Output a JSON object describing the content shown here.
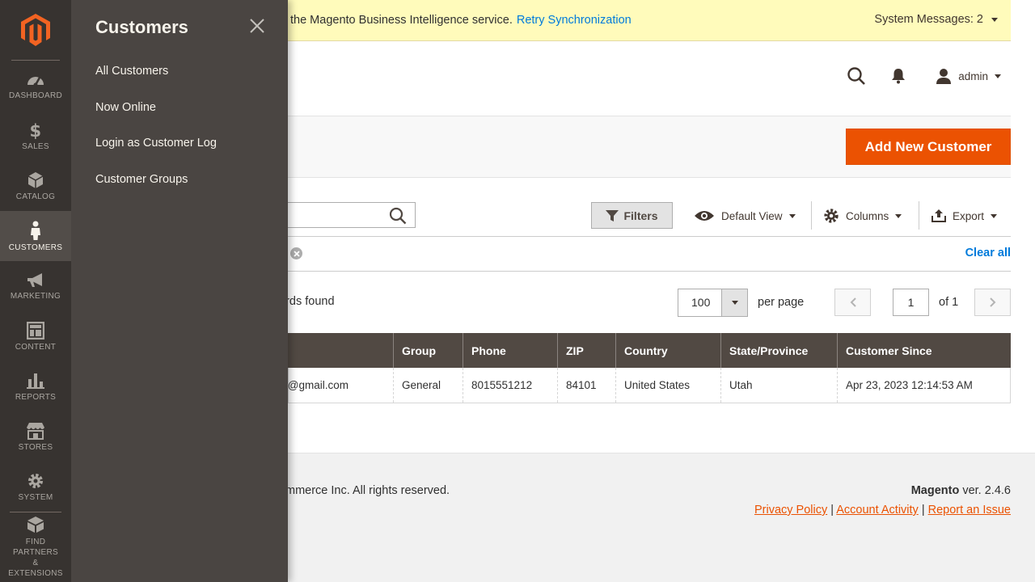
{
  "nav": {
    "items": [
      {
        "label": "DASHBOARD",
        "icon": "dashboard-icon"
      },
      {
        "label": "SALES",
        "icon": "dollar-icon"
      },
      {
        "label": "CATALOG",
        "icon": "box-icon"
      },
      {
        "label": "CUSTOMERS",
        "icon": "person-icon"
      },
      {
        "label": "MARKETING",
        "icon": "megaphone-icon"
      },
      {
        "label": "CONTENT",
        "icon": "layout-icon"
      },
      {
        "label": "REPORTS",
        "icon": "bar-chart-icon"
      },
      {
        "label": "STORES",
        "icon": "store-icon"
      },
      {
        "label": "SYSTEM",
        "icon": "gear-icon"
      }
    ],
    "find": {
      "line1": "FIND",
      "line2": "PARTNERS",
      "line3": "& EXTENSIONS"
    }
  },
  "panel": {
    "title": "Customers",
    "links": [
      "All Customers",
      "Now Online",
      "Login as Customer Log",
      "Customer Groups"
    ]
  },
  "message": {
    "text": "the Magento Business Intelligence service.",
    "retry": "Retry Synchronization",
    "system": "System Messages: 2"
  },
  "header": {
    "user": "admin"
  },
  "actions": {
    "add_label": "Add New Customer"
  },
  "toolbar": {
    "filters": "Filters",
    "view": "Default View",
    "columns": "Columns",
    "export": "Export",
    "clear_all": "Clear all"
  },
  "pager": {
    "records": "ords found",
    "per_page_value": "100",
    "per_page_label": "per page",
    "page": "1",
    "of": "of 1"
  },
  "grid": {
    "headers": [
      "",
      "Group",
      "Phone",
      "ZIP",
      "Country",
      "State/Province",
      "Customer Since"
    ],
    "rows": [
      [
        "r@gmail.com",
        "General",
        "8015551212",
        "84101",
        "United States",
        "Utah",
        "Apr 23, 2023 12:14:53 AM"
      ]
    ]
  },
  "footer": {
    "copyright": "mmerce Inc. All rights reserved.",
    "brand": "Magento",
    "version": " ver. 2.4.6",
    "links": [
      "Privacy Policy",
      "Account Activity",
      "Report an Issue"
    ]
  },
  "colors": {
    "accent": "#eb5202",
    "link": "#007bdb",
    "nav_bg": "#373330",
    "panel_bg": "#4a4542"
  }
}
